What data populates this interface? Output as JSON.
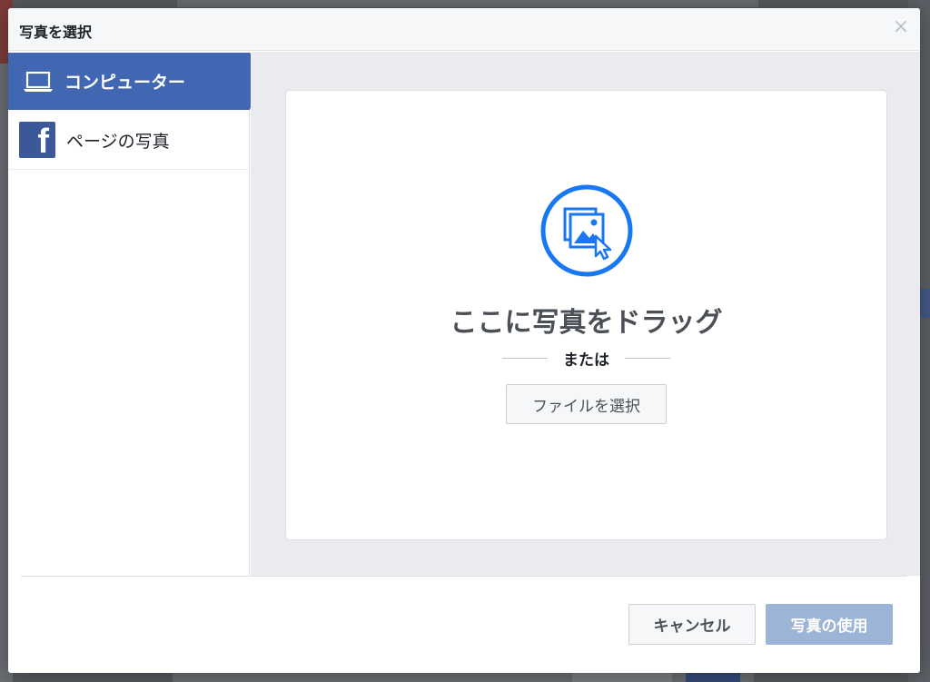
{
  "dialog": {
    "title": "写真を選択",
    "close_symbol": "×"
  },
  "sidebar": {
    "items": [
      {
        "label": "コンピューター",
        "icon": "laptop-icon",
        "active": true
      },
      {
        "label": "ページの写真",
        "icon": "facebook-icon",
        "active": false
      }
    ]
  },
  "dropzone": {
    "icon": "photo-upload-icon",
    "drag_text": "ここに写真をドラッグ",
    "or_text": "または",
    "file_button_label": "ファイルを選択"
  },
  "footer": {
    "cancel_label": "キャンセル",
    "use_label": "写真の使用"
  },
  "colors": {
    "accent": "#4267b2",
    "icon_blue": "#1877f2",
    "disabled_primary": "#9cb4d8"
  }
}
